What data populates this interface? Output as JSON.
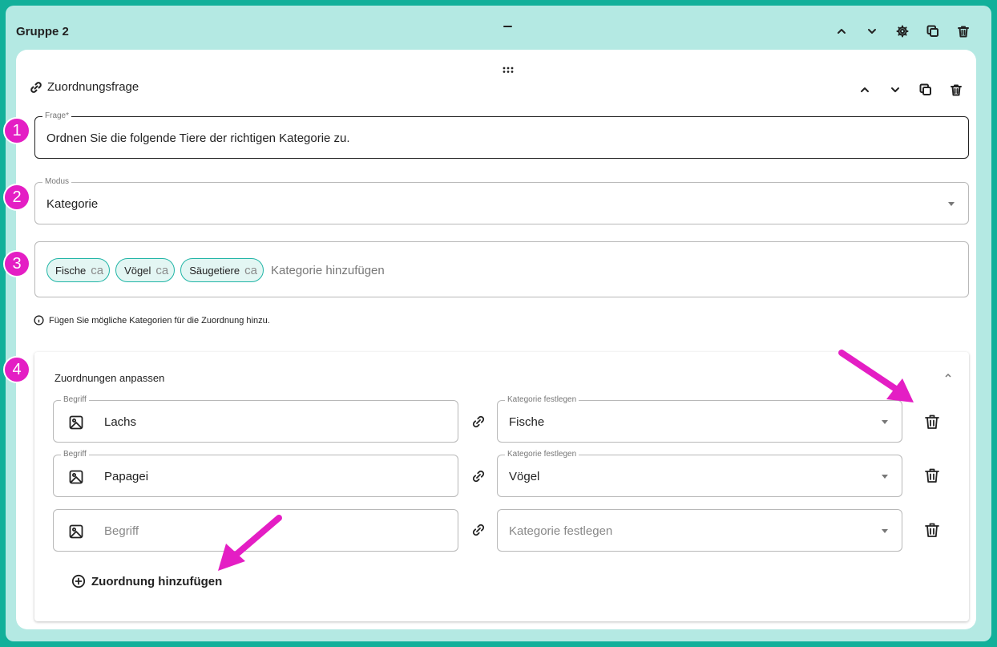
{
  "group": {
    "title": "Gruppe 2"
  },
  "question": {
    "type_label": "Zuordnungsfrage",
    "frage_legend": "Frage*",
    "frage_value": "Ordnen Sie die folgende Tiere der richtigen Kategorie zu.",
    "modus_legend": "Modus",
    "modus_value": "Kategorie",
    "categories": [
      {
        "label": "Fische",
        "delete": "ca"
      },
      {
        "label": "Vögel",
        "delete": "ca"
      },
      {
        "label": "Säugetiere",
        "delete": "ca"
      }
    ],
    "category_input_placeholder": "Kategorie hinzufügen",
    "hint": "Fügen Sie mögliche Kategorien für die Zuordnung hinzu."
  },
  "mappings": {
    "title": "Zuordnungen anpassen",
    "term_legend": "Begriff",
    "category_legend": "Kategorie festlegen",
    "rows": [
      {
        "term": "Lachs",
        "category": "Fische"
      },
      {
        "term": "Papagei",
        "category": "Vögel"
      }
    ],
    "empty_row": {
      "term_placeholder": "Begriff",
      "category_placeholder": "Kategorie festlegen"
    },
    "add_label": "Zuordnung hinzufügen"
  },
  "annotations": {
    "badges": [
      "1",
      "2",
      "3",
      "4"
    ],
    "color": "#e41ec4"
  },
  "colors": {
    "outer": "#12b09a",
    "group_bg": "#b4e9e3",
    "chip_border": "#21b5a6",
    "chip_bg": "#e3f6f3"
  }
}
